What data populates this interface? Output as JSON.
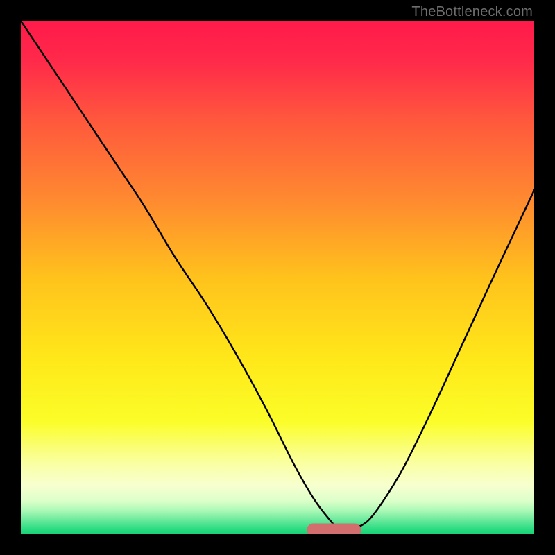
{
  "watermark": "TheBottleneck.com",
  "chart_data": {
    "type": "line",
    "title": "",
    "xlabel": "",
    "ylabel": "",
    "xlim": [
      0,
      100
    ],
    "ylim": [
      0,
      100
    ],
    "legend": false,
    "grid": false,
    "background_gradient_stops": [
      {
        "offset": 0.0,
        "color": "#ff1a4a"
      },
      {
        "offset": 0.08,
        "color": "#ff2a4a"
      },
      {
        "offset": 0.2,
        "color": "#ff5a3c"
      },
      {
        "offset": 0.35,
        "color": "#ff8a30"
      },
      {
        "offset": 0.5,
        "color": "#ffc21c"
      },
      {
        "offset": 0.66,
        "color": "#ffe81a"
      },
      {
        "offset": 0.78,
        "color": "#fbfd28"
      },
      {
        "offset": 0.86,
        "color": "#faffa0"
      },
      {
        "offset": 0.905,
        "color": "#f7ffcf"
      },
      {
        "offset": 0.935,
        "color": "#dcffc9"
      },
      {
        "offset": 0.955,
        "color": "#a8f8b5"
      },
      {
        "offset": 0.972,
        "color": "#6ce99c"
      },
      {
        "offset": 0.99,
        "color": "#2bdc82"
      },
      {
        "offset": 1.0,
        "color": "#1ad178"
      }
    ],
    "series": [
      {
        "name": "bottleneck-curve",
        "color": "#000000",
        "x": [
          0,
          6,
          12,
          18,
          24,
          30,
          36,
          42,
          48,
          53,
          57,
          60,
          62,
          64,
          68,
          74,
          80,
          86,
          92,
          100
        ],
        "y": [
          100,
          91,
          82,
          73,
          64,
          54,
          45,
          35,
          24,
          14,
          7,
          3,
          1,
          1,
          3,
          12,
          24,
          37,
          50,
          67
        ]
      }
    ],
    "marker": {
      "name": "optimal-zone",
      "color": "#d26e6e",
      "x_start": 57,
      "x_end": 65,
      "y": 0.8,
      "thickness": 2.6
    }
  }
}
